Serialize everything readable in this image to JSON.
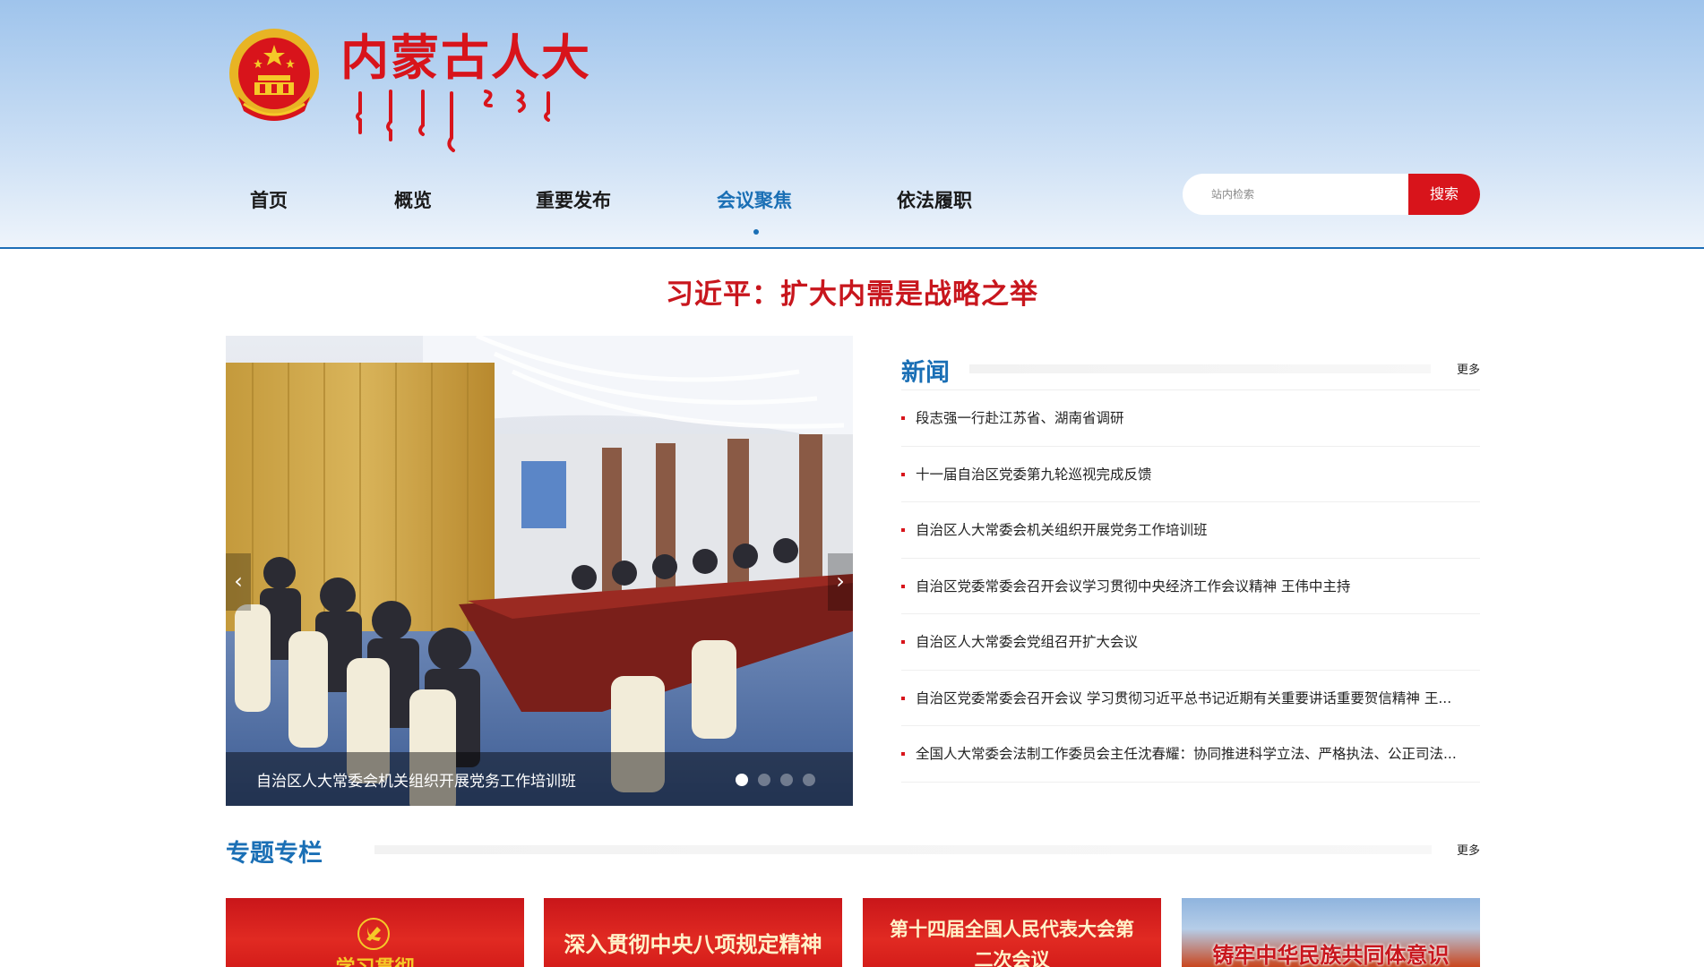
{
  "header": {
    "logo_title": "内蒙古人大",
    "emblem_icon": "national-emblem-icon",
    "nav": [
      {
        "label": "首页",
        "active": false
      },
      {
        "label": "概览",
        "active": false
      },
      {
        "label": "重要发布",
        "active": false
      },
      {
        "label": "会议聚焦",
        "active": true
      },
      {
        "label": "依法履职",
        "active": false
      }
    ],
    "search": {
      "placeholder": "站内检索",
      "button_label": "搜索"
    }
  },
  "headline": "习近平：扩大内需是战略之举",
  "carousel": {
    "caption": "自治区人大常委会机关组织开展党务工作培训班",
    "slide_count": 4,
    "active_slide": 1
  },
  "news": {
    "title": "新闻",
    "more_label": "更多",
    "items": [
      "段志强一行赴江苏省、湖南省调研",
      "十一届自治区党委第九轮巡视完成反馈",
      "自治区人大常委会机关组织开展党务工作培训班",
      "自治区党委常委会召开会议学习贯彻中央经济工作会议精神 王伟中主持",
      "自治区人大常委会党组召开扩大会议",
      "自治区党委常委会召开会议 学习贯彻习近平总书记近期有关重要讲话重要贺信精神 王...",
      "全国人大常委会法制工作委员会主任沈春耀：协同推进科学立法、严格执法、公正司法..."
    ]
  },
  "special": {
    "title": "专题专栏",
    "more_label": "更多",
    "banners": [
      "学习贯彻",
      "深入贯彻中央八项规定精神",
      "第十四届全国人民代表大会第二次会议",
      "铸牢中华民族共同体意识"
    ]
  },
  "colors": {
    "brand_red": "#d8141b",
    "brand_blue": "#1a6fb5"
  }
}
